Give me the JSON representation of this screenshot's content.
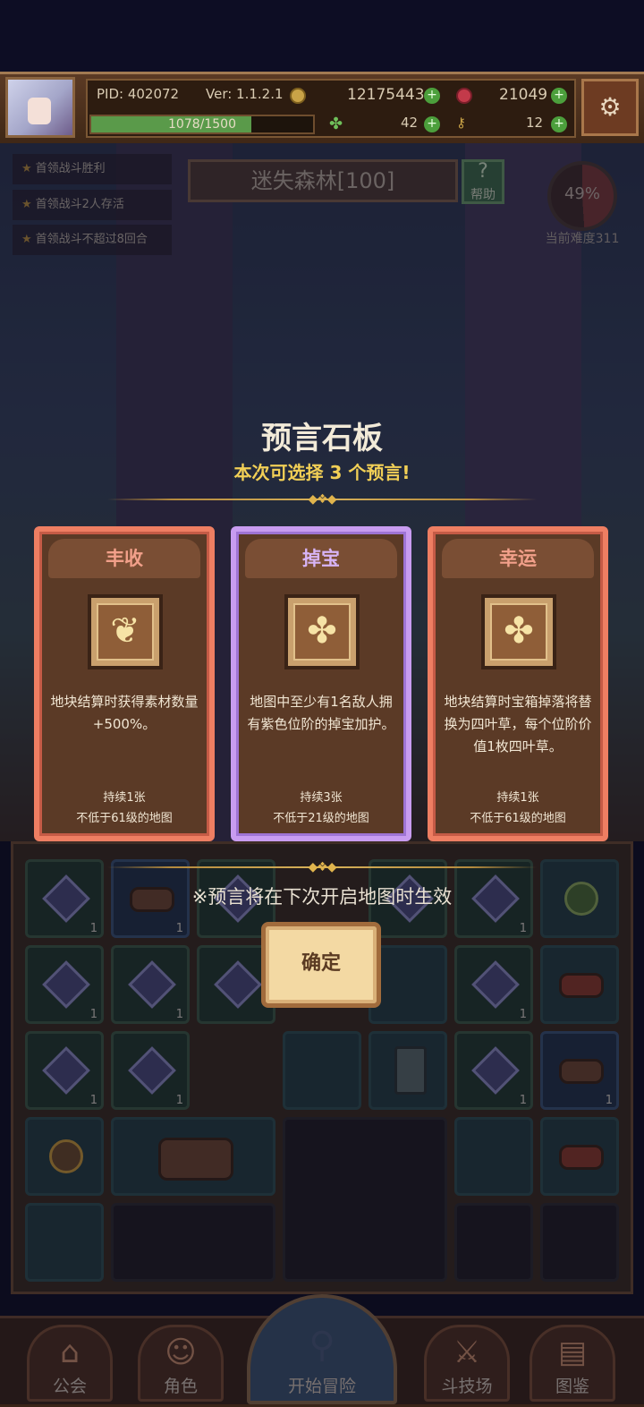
{
  "player": {
    "pid": "PID: 402072",
    "version": "Ver: 1.1.2.1",
    "gold": "12175443",
    "gems": "21049",
    "clovers": "42",
    "keys": "12",
    "exp": "1078/1500",
    "exp_progress": 0.719
  },
  "quests": [
    "首领战斗胜利",
    "首领战斗2人存活",
    "首领战斗不超过8回合"
  ],
  "map": {
    "title": "迷失森林[100]",
    "help_label": "帮助",
    "difficulty_percent": "49%",
    "difficulty_label": "当前难度311"
  },
  "modal": {
    "title": "预言石板",
    "subtitle": "本次可选择 3 个预言!",
    "cards": [
      {
        "name": "丰收",
        "icon": "wheat-icon",
        "desc": "地块结算时获得素材数量+500%。",
        "duration": "持续1张",
        "requirement": "不低于61级的地图",
        "color": "#ee7e62"
      },
      {
        "name": "掉宝",
        "icon": "clover-icon",
        "desc": "地图中至少有1名敌人拥有紫色位阶的掉宝加护。",
        "duration": "持续3张",
        "requirement": "不低于21级的地图",
        "color": "#c89cf0"
      },
      {
        "name": "幸运",
        "icon": "clover-icon",
        "desc": "地块结算时宝箱掉落将替换为四叶草，每个位阶价值1枚四叶草。",
        "duration": "持续1张",
        "requirement": "不低于61级的地图",
        "color": "#ee7e62"
      }
    ],
    "note": "※预言将在下次开启地图时生效",
    "confirm_label": "确定"
  },
  "grid_counts": {
    "c1": "1"
  },
  "nav": {
    "guild": "公会",
    "character": "角色",
    "adventure": "开始冒险",
    "arena": "斗技场",
    "codex": "图鉴"
  }
}
